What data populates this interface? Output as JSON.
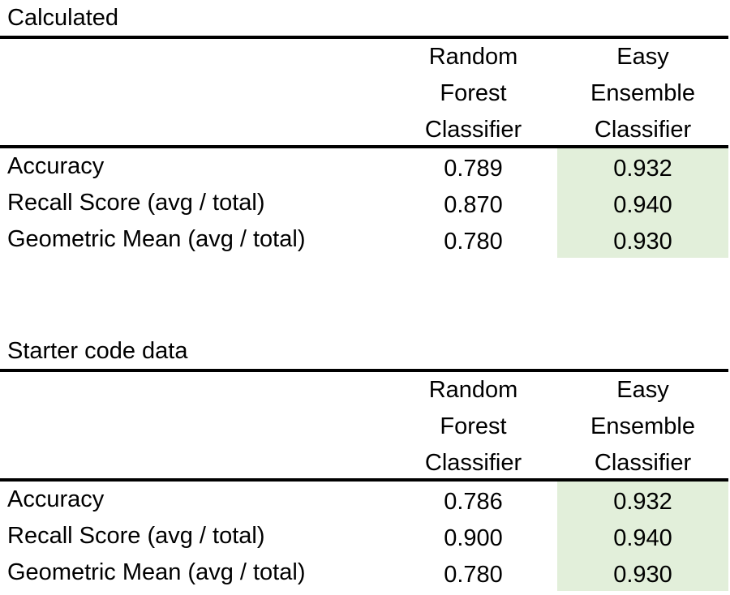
{
  "highlight_color": "#e2efda",
  "tables": [
    {
      "title": "Calculated",
      "columns": [
        [
          "Random",
          "Forest",
          "Classifier"
        ],
        [
          "Easy",
          "Ensemble",
          "Classifier"
        ]
      ],
      "rows": [
        {
          "label": "Accuracy",
          "values": [
            "0.789",
            "0.932"
          ]
        },
        {
          "label": "Recall Score (avg / total)",
          "values": [
            "0.870",
            "0.940"
          ]
        },
        {
          "label": "Geometric Mean (avg / total)",
          "values": [
            "0.780",
            "0.930"
          ]
        }
      ]
    },
    {
      "title": "Starter code data",
      "columns": [
        [
          "Random",
          "Forest",
          "Classifier"
        ],
        [
          "Easy",
          "Ensemble",
          "Classifier"
        ]
      ],
      "rows": [
        {
          "label": "Accuracy",
          "values": [
            "0.786",
            "0.932"
          ]
        },
        {
          "label": "Recall Score (avg / total)",
          "values": [
            "0.900",
            "0.940"
          ]
        },
        {
          "label": "Geometric Mean (avg / total)",
          "values": [
            "0.780",
            "0.930"
          ]
        }
      ]
    }
  ]
}
